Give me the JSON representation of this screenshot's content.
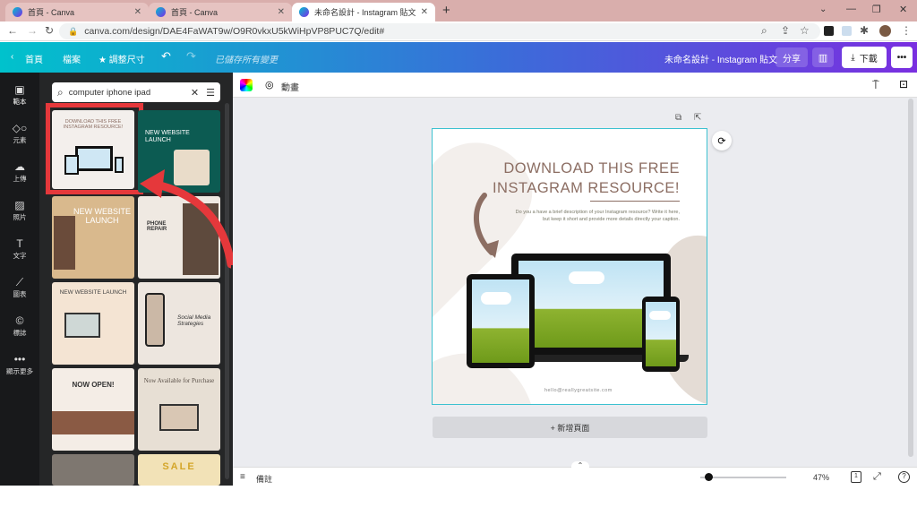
{
  "browser": {
    "tabs": [
      {
        "label": "首頁 - Canva"
      },
      {
        "label": "首頁 - Canva"
      },
      {
        "label": "未命名設計 - Instagram 貼文"
      }
    ],
    "new_tab": "+",
    "url": "canva.com/design/DAE4FaWAT9w/O9R0vkxU5kWiHpVP8PUC7Q/edit#"
  },
  "topbar": {
    "home": "首頁",
    "file": "檔案",
    "resize": "調整尺寸",
    "saved_status": "已儲存所有變更",
    "design_title": "未命名設計 - Instagram 貼文",
    "share": "分享",
    "download": "下載"
  },
  "rail": [
    {
      "label": "範本",
      "icon": "template-icon"
    },
    {
      "label": "元素",
      "icon": "elements-icon"
    },
    {
      "label": "上傳",
      "icon": "upload-icon"
    },
    {
      "label": "照片",
      "icon": "photo-icon"
    },
    {
      "label": "文字",
      "icon": "text-icon"
    },
    {
      "label": "圖表",
      "icon": "chart-icon"
    },
    {
      "label": "標誌",
      "icon": "logo-icon"
    },
    {
      "label": "顯示更多",
      "icon": "more-icon"
    }
  ],
  "panel": {
    "search_value": "computer iphone ipad",
    "thumbs": [
      {
        "title": "DOWNLOAD THIS FREE INSTAGRAM RESOURCE!"
      },
      {
        "title": "NEW WEBSITE LAUNCH"
      },
      {
        "title": "NEW WEBSITE LAUNCH"
      },
      {
        "title": "PHONE REPAIR"
      },
      {
        "title": "NEW WEBSITE LAUNCH"
      },
      {
        "title": "Social Media Strategies"
      },
      {
        "title": "NOW OPEN!"
      },
      {
        "title": "Now Available for Purchase"
      },
      {
        "title": ""
      },
      {
        "title": "SALE"
      }
    ]
  },
  "canvas_toolbar": {
    "animate": "動畫"
  },
  "design": {
    "headline_1": "DOWNLOAD THIS FREE",
    "headline_2": "INSTAGRAM RESOURCE!",
    "desc_1": "Do you a have a brief description of your Instagram resource? Write it here,",
    "desc_2": "but keep it short and provide more details directly your caption.",
    "email": "hello@reallygreatsite.com"
  },
  "add_page": "+ 新增頁面",
  "bottom": {
    "notes": "備註",
    "zoom": "47%",
    "page_count": "1",
    "zoom_level": 0.47
  },
  "colors": {
    "accent": "#3cc1d0",
    "highlight": "#e5383b",
    "arrow": "#8c6e63"
  }
}
